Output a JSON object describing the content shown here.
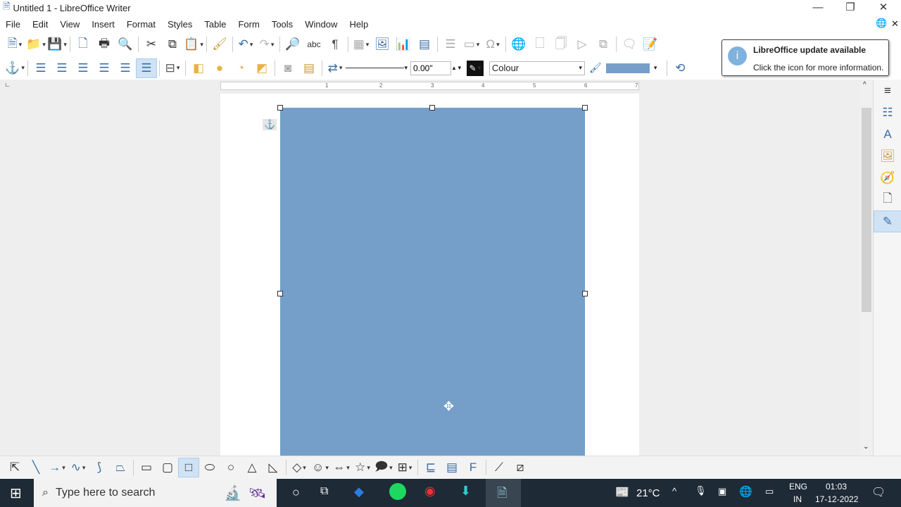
{
  "window": {
    "title": "Untitled 1 - LibreOffice Writer",
    "minimize": "—",
    "restore": "❐",
    "close": "✕"
  },
  "menu": [
    "File",
    "Edit",
    "View",
    "Insert",
    "Format",
    "Styles",
    "Table",
    "Form",
    "Tools",
    "Window",
    "Help"
  ],
  "toolbar_standard": [
    "new-document",
    "open",
    "save",
    "export-pdf",
    "print",
    "print-preview",
    "cut",
    "copy",
    "paste",
    "clone-formatting",
    "undo",
    "redo",
    "find-replace",
    "spelling",
    "formatting-marks",
    "table",
    "image",
    "chart",
    "text-box",
    "page-break",
    "field",
    "special-character",
    "hyperlink",
    "footnote",
    "endnote",
    "bookmark",
    "cross-reference",
    "comment",
    "track-changes"
  ],
  "toolbar_frame": {
    "line_width": "0.00\"",
    "area_style": "Colour",
    "fill_color": "#759fc8"
  },
  "notification": {
    "title": "LibreOffice update available",
    "body": "Click the icon for more information."
  },
  "ruler_ticks": [
    "1",
    "2",
    "3",
    "4",
    "5",
    "6",
    "7"
  ],
  "shape": {
    "fill": "#759fc8"
  },
  "taskbar": {
    "search_placeholder": "Type here to search",
    "weather": "21°C",
    "lang1": "ENG",
    "lang2": "IN",
    "time": "01:03",
    "date": "17-12-2022"
  }
}
